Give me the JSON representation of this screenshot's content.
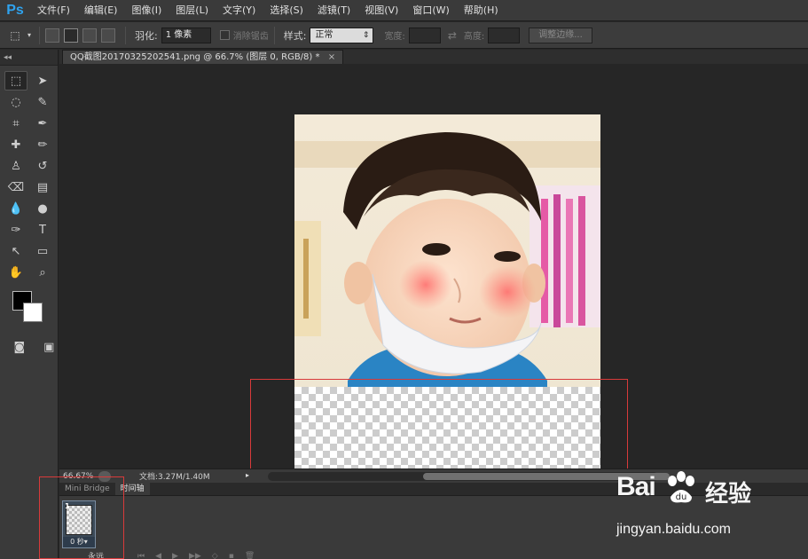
{
  "app": {
    "logo": "Ps",
    "menus": [
      "文件(F)",
      "编辑(E)",
      "图像(I)",
      "图层(L)",
      "文字(Y)",
      "选择(S)",
      "滤镜(T)",
      "视图(V)",
      "窗口(W)",
      "帮助(H)"
    ]
  },
  "options": {
    "feather_label": "羽化:",
    "feather_value": "1 像素",
    "antialias_label": "消除锯齿",
    "style_label": "样式:",
    "style_value": "正常",
    "width_label": "宽度:",
    "height_label": "高度:",
    "refine_edge_label": "调整边缘..."
  },
  "document": {
    "tab_title": "QQ截图20170325202541.png @ 66.7% (图层 0, RGB/8) *",
    "close": "×"
  },
  "status": {
    "zoom": "66.67%",
    "doc_info": "文档:3.27M/1.40M",
    "menu_arrow": "▸"
  },
  "timeline": {
    "tabs": [
      "Mini Bridge",
      "时间轴"
    ],
    "active_tab": 1,
    "frame_number": "1",
    "frame_delay": "0 秒▾",
    "loop_label": "永远"
  },
  "watermark": {
    "brand": "Bai",
    "brand_cn": "经验",
    "url": "jingyan.baidu.com"
  },
  "colors": {
    "foreground": "#000000",
    "background": "#ffffff",
    "highlight": "#d83a3a"
  }
}
